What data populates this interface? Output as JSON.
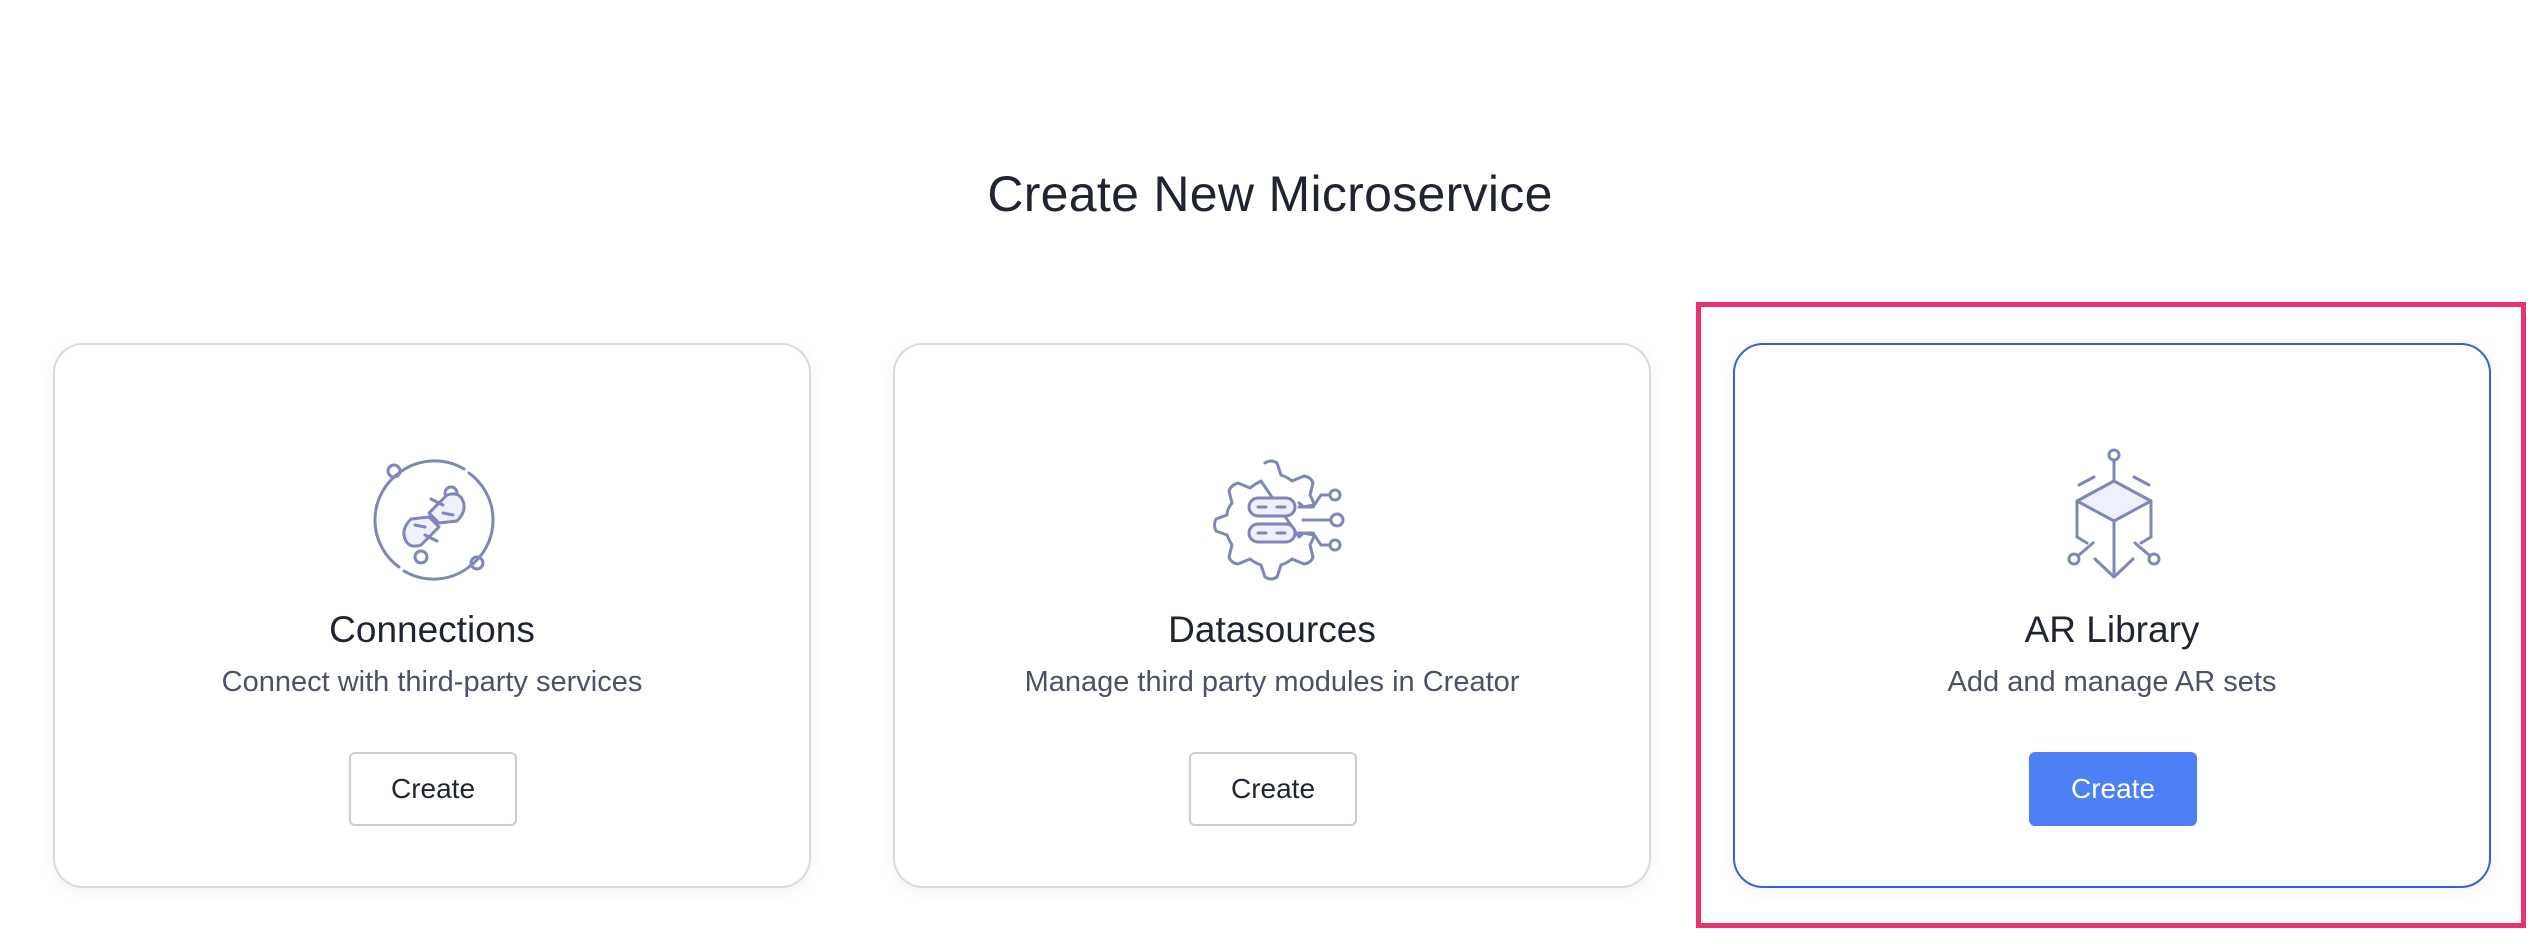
{
  "page": {
    "title": "Create New Microservice"
  },
  "cards": [
    {
      "title": "Connections",
      "description": "Connect with third-party services",
      "button_label": "Create",
      "icon": "plug-connection-icon",
      "selected": false
    },
    {
      "title": "Datasources",
      "description": "Manage third party modules in Creator",
      "button_label": "Create",
      "icon": "database-gear-icon",
      "selected": false
    },
    {
      "title": "AR Library",
      "description": "Add and manage AR sets",
      "button_label": "Create",
      "icon": "ar-cube-icon",
      "selected": true
    }
  ],
  "colors": {
    "accent": "#4d7ff5",
    "selected_border": "#2f63e0",
    "highlight_frame": "#e8336c",
    "icon_stroke": "#7f87b6",
    "text_primary": "#1f2430",
    "text_secondary": "#4a5168"
  }
}
